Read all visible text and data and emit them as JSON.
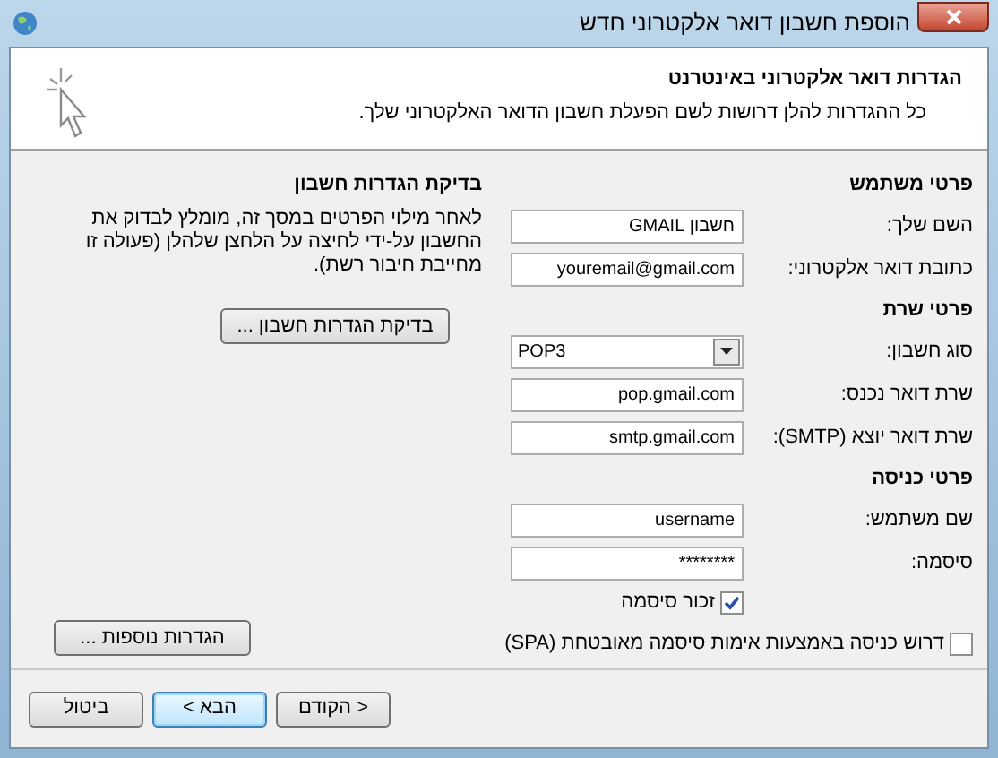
{
  "window": {
    "title": "הוספת חשבון דואר אלקטרוני חדש"
  },
  "header": {
    "title": "הגדרות דואר אלקטרוני באינטרנט",
    "description": "כל ההגדרות להלן דרושות לשם הפעלת חשבון הדואר האלקטרוני שלך."
  },
  "sections": [
    {
      "heading": "פרטי משתמש",
      "fields": [
        {
          "kind": "text",
          "label": "השם שלך:",
          "value": "חשבון GMAIL"
        },
        {
          "kind": "text",
          "label": "כתובת דואר אלקטרוני:",
          "value": "youremail@gmail.com"
        }
      ]
    },
    {
      "heading": "פרטי שרת",
      "fields": [
        {
          "kind": "dropdown",
          "label": "סוג חשבון:",
          "value": "POP3"
        },
        {
          "kind": "text",
          "label": "שרת דואר נכנס:",
          "value": "pop.gmail.com"
        },
        {
          "kind": "text",
          "label": "שרת דואר יוצא (SMTP):",
          "value": "smtp.gmail.com"
        }
      ]
    },
    {
      "heading": "פרטי כניסה",
      "fields": [
        {
          "kind": "text",
          "label": "שם משתמש:",
          "value": "username"
        },
        {
          "kind": "text",
          "label": "סיסמה:",
          "value": "********"
        }
      ]
    }
  ],
  "remember_password": {
    "label": "זכור סיסמה",
    "checked": true
  },
  "spa": {
    "label": "דרוש כניסה באמצעות אימות סיסמה מאובטחת (SPA)",
    "checked": false
  },
  "test": {
    "heading": "בדיקת הגדרות חשבון",
    "description": "לאחר מילוי הפרטים במסך זה, מומלץ לבדוק את החשבון על-ידי לחיצה על הלחצן שלהלן (פעולה זו מחייבת חיבור רשת).",
    "button": "בדיקת הגדרות חשבון ..."
  },
  "more_settings_button": "הגדרות נוספות ...",
  "footer_buttons": [
    {
      "label": "< הקודם",
      "default": false
    },
    {
      "label": "הבא >",
      "default": true
    },
    {
      "label": "ביטול",
      "default": false
    }
  ]
}
